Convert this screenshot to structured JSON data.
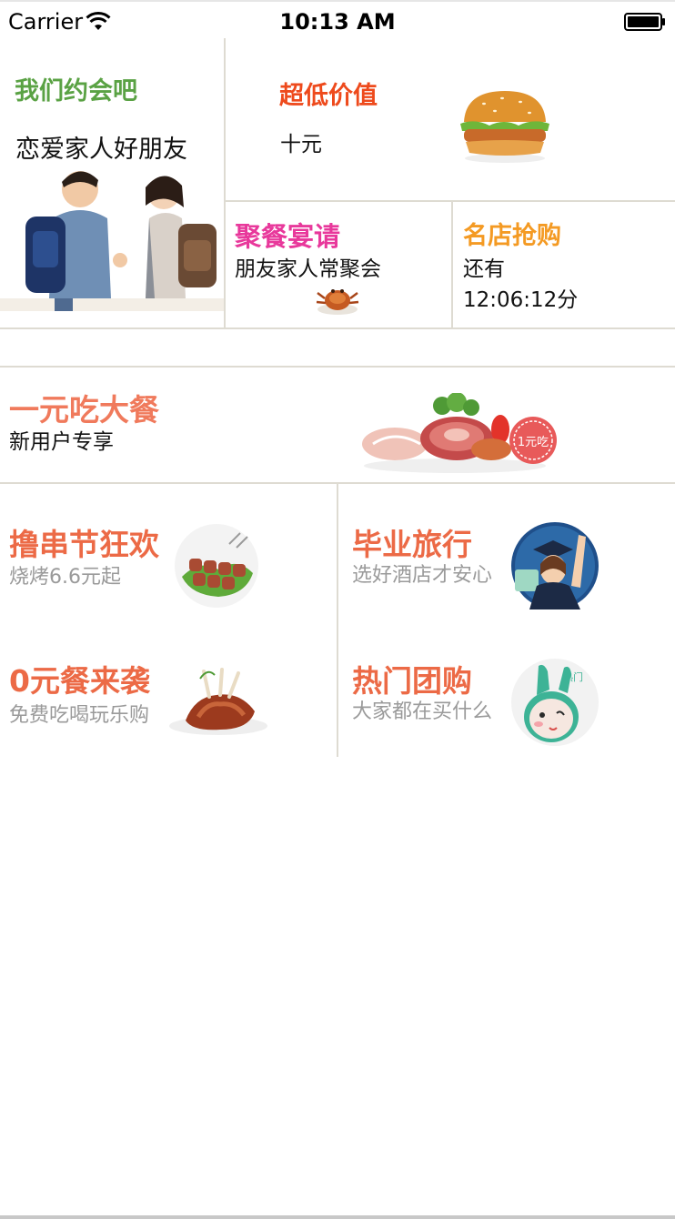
{
  "status_bar": {
    "carrier": "Carrier",
    "time": "10:13 AM"
  },
  "top_left": {
    "title": "我们约会吧",
    "subtitle": "恋爱家人好朋友",
    "image_icon": "couple-photo"
  },
  "top_right": {
    "title": "超低价值",
    "subtitle": "十元",
    "image_icon": "burger-image"
  },
  "middle_left": {
    "title": "聚餐宴请",
    "subtitle": "朋友家人常聚会",
    "image_icon": "crab-image"
  },
  "middle_right": {
    "title": "名店抢购",
    "subtitle": "还有",
    "countdown": "12:06:12分"
  },
  "banner": {
    "title": "一元吃大餐",
    "subtitle": "新用户专享",
    "badge": "1元吃"
  },
  "grid": [
    {
      "title": "撸串节狂欢",
      "subtitle": "烧烤6.6元起",
      "image_icon": "skewers-image"
    },
    {
      "title": "毕业旅行",
      "subtitle": "选好酒店才安心",
      "image_icon": "graduate-image"
    },
    {
      "title": "0元餐来袭",
      "subtitle": "免费吃喝玩乐购",
      "image_icon": "ribs-image"
    },
    {
      "title": "热门团购",
      "subtitle": "大家都在买什么",
      "image_icon": "mascot-image",
      "badge": "热门"
    }
  ],
  "colors": {
    "green_title": "#5aa244",
    "red_title": "#ee4a1c",
    "pink_title": "#e8389b",
    "orange_title": "#f49a23",
    "coral_title": "#ec6a46",
    "divider": "#dedbd2"
  }
}
